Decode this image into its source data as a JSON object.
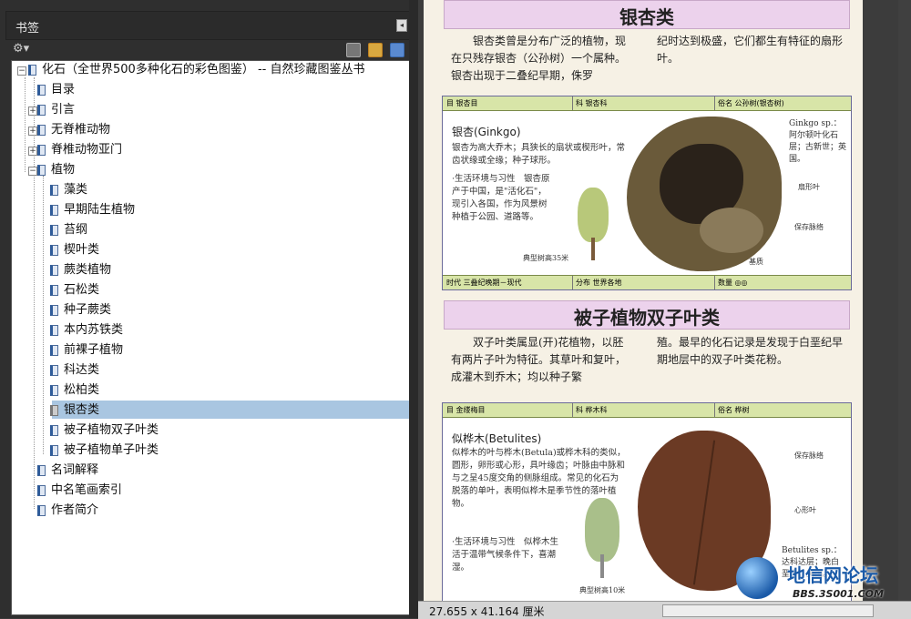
{
  "panel": {
    "title": "书签",
    "collapse_icon": "panel-collapse-icon",
    "toolbar_icons": [
      "options-gear-icon",
      "delete-bookmark-icon",
      "new-bookmark-icon",
      "bookmark-properties-icon"
    ]
  },
  "tree": {
    "root": "化石（全世界500多种化石的彩色图鉴） -- 自然珍藏图鉴丛书",
    "items": [
      {
        "label": "目录"
      },
      {
        "label": "引言"
      },
      {
        "label": "无脊椎动物"
      },
      {
        "label": "脊椎动物亚门"
      },
      {
        "label": "植物"
      },
      {
        "label": "藻类"
      },
      {
        "label": "早期陆生植物"
      },
      {
        "label": "苔纲"
      },
      {
        "label": "楔叶类"
      },
      {
        "label": "蕨类植物"
      },
      {
        "label": "石松类"
      },
      {
        "label": "种子蕨类"
      },
      {
        "label": "本内苏铁类"
      },
      {
        "label": "前裸子植物"
      },
      {
        "label": "科达类"
      },
      {
        "label": "松柏类"
      },
      {
        "label": "银杏类"
      },
      {
        "label": "被子植物双子叶类"
      },
      {
        "label": "被子植物单子叶类"
      },
      {
        "label": "名词解释"
      },
      {
        "label": "中名笔画索引"
      },
      {
        "label": "作者简介"
      }
    ],
    "selected": "银杏类"
  },
  "doc": {
    "section1": {
      "title": "银杏类",
      "para_left": "银杏类曾是分布广泛的植物，现在只残存银杏（公孙树）一个属种。银杏出现于二叠纪早期，侏罗",
      "para_right": "纪时达到极盛，它们都生有特征的扇形叶。",
      "card": {
        "order": "目 银杏目",
        "family": "科 银杏科",
        "alias": "俗名 公孙树(银杏树)",
        "name": "银杏(Ginkgo)",
        "desc": "银杏为高大乔木；具狭长的扇状或楔形叶，常齿状缘或全缘；种子球形。",
        "habitat": "·生活环境与习性　银杏原产于中国，是\"活化石\"，现引入各国，作为风景树种植于公园、道路等。",
        "tree_height": "典型树高35米",
        "side": "Ginkgo sp.：阿尔顿叶化石层；古新世；英国。",
        "lbl1": "扇形叶",
        "lbl2": "保存脉络",
        "lbl3": "基质",
        "era": "时代 三叠纪晚期－现代",
        "dist": "分布 世界各地",
        "qty": "数量 ◎◎"
      }
    },
    "section2": {
      "title": "被子植物双子叶类",
      "para_left": "双子叶类属显(开)花植物，以胚有两片子叶为特征。其草叶和复叶，成灌木到乔木；均以种子繁",
      "para_right": "殖。最早的化石记录是发现于白垩纪早期地层中的双子叶类花粉。",
      "card": {
        "order": "目 金缕梅目",
        "family": "科 桦木科",
        "alias": "俗名 桦树",
        "name": "似桦木(Betulites)",
        "desc": "似桦木的叶与桦木(Betula)或桦木科的类似，圆形，卵形或心形，具叶缘齿；叶脉由中脉和与之呈45度交角的侧脉组成。常见的化石为脱落的单叶，表明似桦木是季节性的落叶植物。",
        "habitat": "·生活环境与习性　似桦木生活于温带气候条件下，喜潮湿。",
        "tree_height": "典型树高10米",
        "side": "Betulites sp.：达科达层；晚白垩世；美国。",
        "lbl1": "保存脉络",
        "lbl2": "心形叶"
      }
    }
  },
  "status": {
    "dimensions": "27.655 x 41.164 厘米"
  },
  "watermark": {
    "title": "地信网论坛",
    "url": "BBS.3S001.COM"
  }
}
